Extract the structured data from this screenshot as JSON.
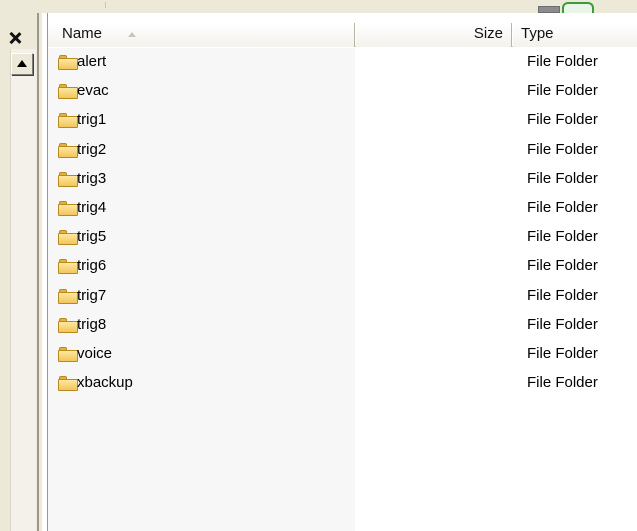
{
  "columns": {
    "name": "Name",
    "size": "Size",
    "type": "Type"
  },
  "files": [
    {
      "name": "alert",
      "size": "",
      "type": "File Folder",
      "icon": "folder-icon"
    },
    {
      "name": "evac",
      "size": "",
      "type": "File Folder",
      "icon": "folder-icon"
    },
    {
      "name": "trig1",
      "size": "",
      "type": "File Folder",
      "icon": "folder-icon"
    },
    {
      "name": "trig2",
      "size": "",
      "type": "File Folder",
      "icon": "folder-icon"
    },
    {
      "name": "trig3",
      "size": "",
      "type": "File Folder",
      "icon": "folder-icon"
    },
    {
      "name": "trig4",
      "size": "",
      "type": "File Folder",
      "icon": "folder-icon"
    },
    {
      "name": "trig5",
      "size": "",
      "type": "File Folder",
      "icon": "folder-icon"
    },
    {
      "name": "trig6",
      "size": "",
      "type": "File Folder",
      "icon": "folder-icon"
    },
    {
      "name": "trig7",
      "size": "",
      "type": "File Folder",
      "icon": "folder-icon"
    },
    {
      "name": "trig8",
      "size": "",
      "type": "File Folder",
      "icon": "folder-icon"
    },
    {
      "name": "voice",
      "size": "",
      "type": "File Folder",
      "icon": "folder-icon"
    },
    {
      "name": "xbackup",
      "size": "",
      "type": "File Folder",
      "icon": "folder-icon"
    }
  ],
  "left_pane": {
    "close_icon": "close-icon",
    "scroll_up_icon": "scroll-up-arrow-icon"
  },
  "sort": {
    "column": "name",
    "direction": "ascending"
  },
  "colors": {
    "chrome": "#ece9d8",
    "folder": "#f1c65a",
    "list_border": "#7f9db9"
  }
}
